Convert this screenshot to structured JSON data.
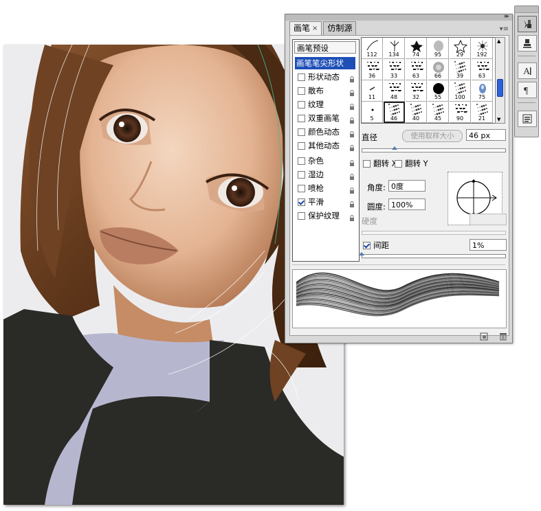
{
  "panel": {
    "tabs": [
      {
        "label": "画笔",
        "close": "×"
      },
      {
        "label": "仿制源"
      }
    ],
    "collapse_icon": "▸▸",
    "menu_icon": "▾≡"
  },
  "sidebar": {
    "preset_label": "画笔预设",
    "items": [
      {
        "label": "画笔笔尖形状",
        "checked": null,
        "selected": true
      },
      {
        "label": "形状动态",
        "checked": false
      },
      {
        "label": "散布",
        "checked": false
      },
      {
        "label": "纹理",
        "checked": false
      },
      {
        "label": "双重画笔",
        "checked": false
      },
      {
        "label": "颜色动态",
        "checked": false
      },
      {
        "label": "其他动态",
        "checked": false
      },
      {
        "label": "杂色",
        "checked": false
      },
      {
        "label": "湿边",
        "checked": false
      },
      {
        "label": "喷枪",
        "checked": false
      },
      {
        "label": "平滑",
        "checked": true
      },
      {
        "label": "保护纹理",
        "checked": false
      }
    ]
  },
  "brush_grid": {
    "rows": [
      [
        "112",
        "134",
        "74",
        "95",
        "29",
        "192"
      ],
      [
        "36",
        "33",
        "63",
        "66",
        "39",
        "63"
      ],
      [
        "11",
        "48",
        "32",
        "55",
        "100",
        "75"
      ],
      [
        "5",
        "46",
        "40",
        "45",
        "90",
        "21"
      ]
    ],
    "selected": "46"
  },
  "tip": {
    "diameter_label": "直径",
    "use_sample_label": "使用取样大小",
    "diameter_value": "46 px",
    "flip_x_label": "翻转 X",
    "flip_y_label": "翻转 Y",
    "angle_label": "角度:",
    "angle_value": "0度",
    "roundness_label": "圆度:",
    "roundness_value": "100%",
    "hardness_label": "硬度",
    "spacing_label": "间距",
    "spacing_checked": true,
    "spacing_value": "1%"
  },
  "dock": {
    "icons": [
      "brush-tool-icon",
      "clone-stamp-icon",
      "character-icon",
      "paragraph-icon",
      "notes-icon"
    ]
  },
  "colors": {
    "selection": "#1e4fb7",
    "panel_bg": "#d8d8d8",
    "inner_bg": "#f0f0f0"
  }
}
